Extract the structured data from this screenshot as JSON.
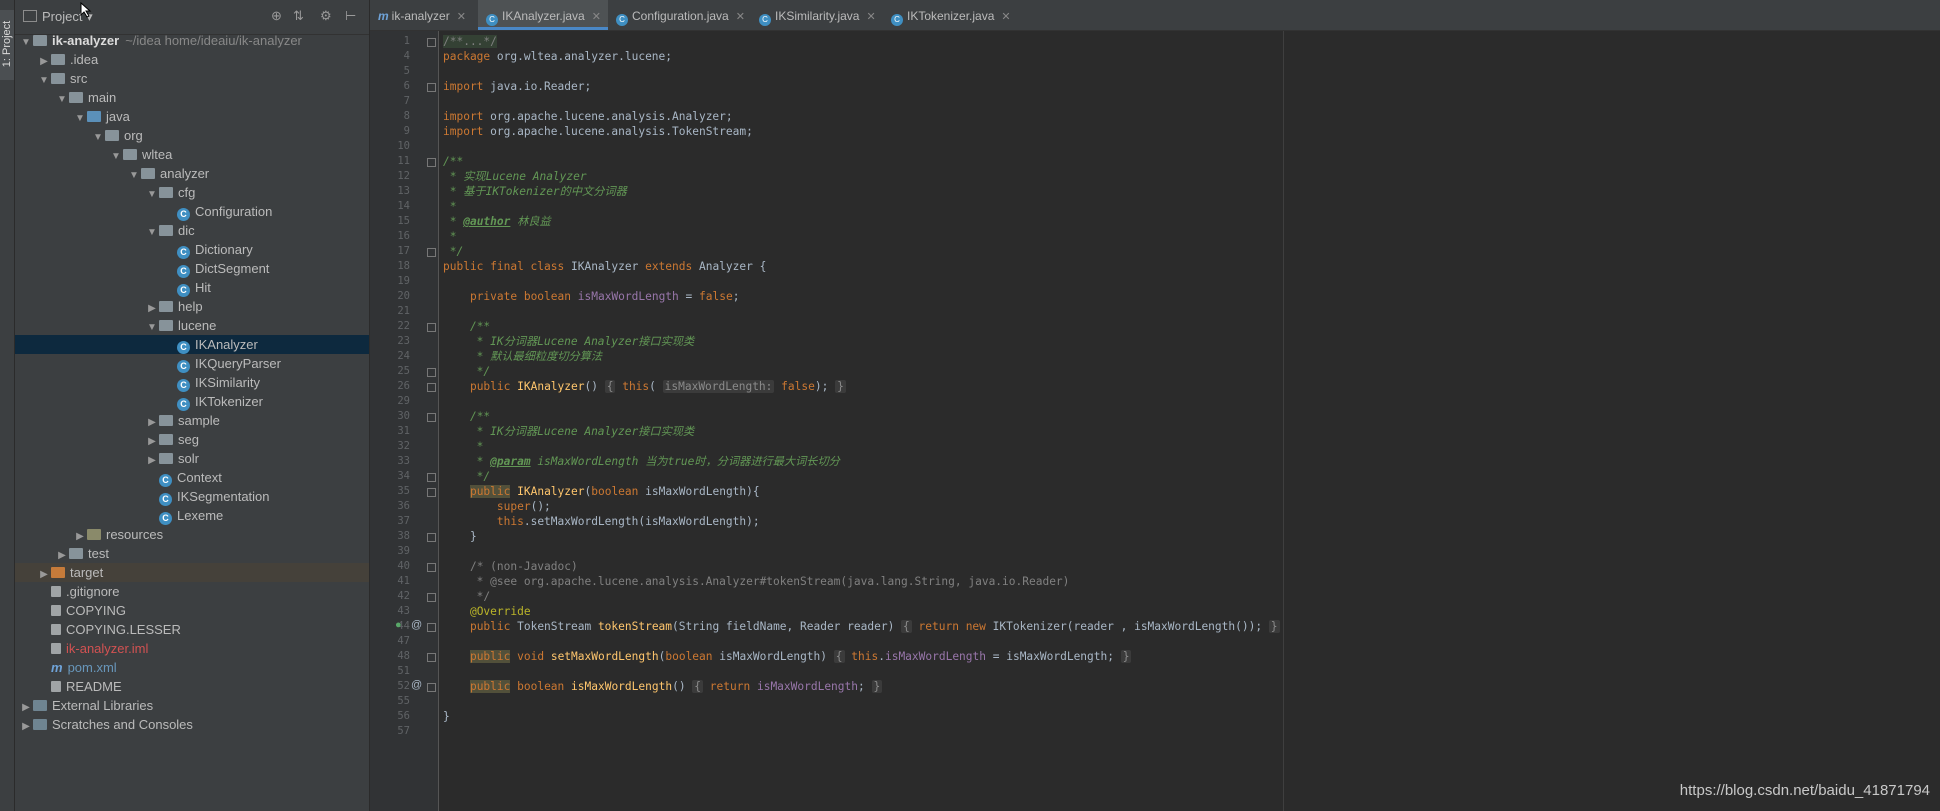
{
  "sidebar_strip": {
    "tab_label": "1: Project"
  },
  "project_panel": {
    "title": "Project",
    "tree": [
      {
        "label": "ik-analyzer",
        "suffix": "~/idea home/ideaiu/ik-analyzer",
        "depth": 0,
        "arrow": "down",
        "icon": "project-folder",
        "bold": true
      },
      {
        "label": ".idea",
        "depth": 1,
        "arrow": "right",
        "icon": "folder"
      },
      {
        "label": "src",
        "depth": 1,
        "arrow": "down",
        "icon": "folder"
      },
      {
        "label": "main",
        "depth": 2,
        "arrow": "down",
        "icon": "folder"
      },
      {
        "label": "java",
        "depth": 3,
        "arrow": "down",
        "icon": "source-folder"
      },
      {
        "label": "org",
        "depth": 4,
        "arrow": "down",
        "icon": "package"
      },
      {
        "label": "wltea",
        "depth": 5,
        "arrow": "down",
        "icon": "package"
      },
      {
        "label": "analyzer",
        "depth": 6,
        "arrow": "down",
        "icon": "package"
      },
      {
        "label": "cfg",
        "depth": 7,
        "arrow": "down",
        "icon": "package"
      },
      {
        "label": "Configuration",
        "depth": 8,
        "arrow": "none",
        "icon": "class"
      },
      {
        "label": "dic",
        "depth": 7,
        "arrow": "down",
        "icon": "package"
      },
      {
        "label": "Dictionary",
        "depth": 8,
        "arrow": "none",
        "icon": "class"
      },
      {
        "label": "DictSegment",
        "depth": 8,
        "arrow": "none",
        "icon": "class"
      },
      {
        "label": "Hit",
        "depth": 8,
        "arrow": "none",
        "icon": "class"
      },
      {
        "label": "help",
        "depth": 7,
        "arrow": "right",
        "icon": "package"
      },
      {
        "label": "lucene",
        "depth": 7,
        "arrow": "down",
        "icon": "package"
      },
      {
        "label": "IKAnalyzer",
        "depth": 8,
        "arrow": "none",
        "icon": "class",
        "selected": true
      },
      {
        "label": "IKQueryParser",
        "depth": 8,
        "arrow": "none",
        "icon": "class"
      },
      {
        "label": "IKSimilarity",
        "depth": 8,
        "arrow": "none",
        "icon": "class"
      },
      {
        "label": "IKTokenizer",
        "depth": 8,
        "arrow": "none",
        "icon": "class"
      },
      {
        "label": "sample",
        "depth": 7,
        "arrow": "right",
        "icon": "package"
      },
      {
        "label": "seg",
        "depth": 7,
        "arrow": "right",
        "icon": "package"
      },
      {
        "label": "solr",
        "depth": 7,
        "arrow": "right",
        "icon": "package"
      },
      {
        "label": "Context",
        "depth": 7,
        "arrow": "none",
        "icon": "class"
      },
      {
        "label": "IKSegmentation",
        "depth": 7,
        "arrow": "none",
        "icon": "class"
      },
      {
        "label": "Lexeme",
        "depth": 7,
        "arrow": "none",
        "icon": "class"
      },
      {
        "label": "resources",
        "depth": 3,
        "arrow": "right",
        "icon": "resources-folder"
      },
      {
        "label": "test",
        "depth": 2,
        "arrow": "right",
        "icon": "folder"
      },
      {
        "label": "target",
        "depth": 1,
        "arrow": "right",
        "icon": "target-folder",
        "dim": true
      },
      {
        "label": ".gitignore",
        "depth": 1,
        "arrow": "none",
        "icon": "file"
      },
      {
        "label": "COPYING",
        "depth": 1,
        "arrow": "none",
        "icon": "file"
      },
      {
        "label": "COPYING.LESSER",
        "depth": 1,
        "arrow": "none",
        "icon": "file"
      },
      {
        "label": "ik-analyzer.iml",
        "depth": 1,
        "arrow": "none",
        "icon": "file",
        "color": "red"
      },
      {
        "label": "pom.xml",
        "depth": 1,
        "arrow": "none",
        "icon": "maven",
        "color": "blue"
      },
      {
        "label": "README",
        "depth": 1,
        "arrow": "none",
        "icon": "file"
      },
      {
        "label": "External Libraries",
        "depth": 0,
        "arrow": "right",
        "icon": "library"
      },
      {
        "label": "Scratches and Consoles",
        "depth": 0,
        "arrow": "right",
        "icon": "scratches"
      }
    ]
  },
  "editor": {
    "tabs": [
      {
        "label": "ik-analyzer",
        "icon": "maven",
        "active": false
      },
      {
        "label": "IKAnalyzer.java",
        "icon": "class",
        "active": true
      },
      {
        "label": "Configuration.java",
        "icon": "class",
        "active": false
      },
      {
        "label": "IKSimilarity.java",
        "icon": "class",
        "active": false
      },
      {
        "label": "IKTokenizer.java",
        "icon": "class",
        "active": false
      }
    ],
    "lines": [
      {
        "n": "1",
        "html": "<span class=\"cm hl\">/**...*/</span>"
      },
      {
        "n": "4",
        "html": "<span class=\"kw\">package</span> org.wltea.analyzer.lucene;"
      },
      {
        "n": "5",
        "html": ""
      },
      {
        "n": "6",
        "html": "<span class=\"kw\">import</span> java.io.Reader;"
      },
      {
        "n": "7",
        "html": ""
      },
      {
        "n": "8",
        "html": "<span class=\"kw\">import</span> org.apache.lucene.analysis.Analyzer;"
      },
      {
        "n": "9",
        "html": "<span class=\"kw\">import</span> org.apache.lucene.analysis.TokenStream;"
      },
      {
        "n": "10",
        "html": ""
      },
      {
        "n": "11",
        "html": "<span class=\"jd\">/**</span>"
      },
      {
        "n": "12",
        "html": "<span class=\"jd\"> * 实现Lucene Analyzer</span>"
      },
      {
        "n": "13",
        "html": "<span class=\"jd\"> * 基于IKTokenizer的中文分词器</span>"
      },
      {
        "n": "14",
        "html": "<span class=\"jd\"> *</span>"
      },
      {
        "n": "15",
        "html": "<span class=\"jd\"> * </span><span class=\"jdt\">@author</span><span class=\"jd\"> 林良益</span>"
      },
      {
        "n": "16",
        "html": "<span class=\"jd\"> *</span>"
      },
      {
        "n": "17",
        "html": "<span class=\"jd\"> */</span>"
      },
      {
        "n": "18",
        "html": "<span class=\"kw\">public final class</span> IKAnalyzer <span class=\"kw\">extends</span> Analyzer {"
      },
      {
        "n": "19",
        "html": ""
      },
      {
        "n": "20",
        "html": "    <span class=\"kw\">private boolean</span> <span class=\"fld\">isMaxWordLength</span> = <span class=\"kw\">false</span>;"
      },
      {
        "n": "21",
        "html": ""
      },
      {
        "n": "22",
        "html": "    <span class=\"jd\">/**</span>"
      },
      {
        "n": "23",
        "html": "<span class=\"jd\">     * IK分词器Lucene Analyzer接口实现类</span>"
      },
      {
        "n": "24",
        "html": "<span class=\"jd\">     * 默认最细粒度切分算法</span>"
      },
      {
        "n": "25",
        "html": "<span class=\"jd\">     */</span>"
      },
      {
        "n": "26",
        "html": "    <span class=\"kw\">public</span> <span class=\"fn\">IKAnalyzer</span>() <span class=\"hint\">{</span> <span class=\"kw\">this</span>( <span class=\"hint\">isMaxWordLength:</span> <span class=\"kw\">false</span>); <span class=\"hint\">}</span>"
      },
      {
        "n": "29",
        "html": ""
      },
      {
        "n": "30",
        "html": "    <span class=\"jd\">/**</span>"
      },
      {
        "n": "31",
        "html": "<span class=\"jd\">     * IK分词器Lucene Analyzer接口实现类</span>"
      },
      {
        "n": "32",
        "html": "<span class=\"jd\">     *</span>"
      },
      {
        "n": "33",
        "html": "<span class=\"jd\">     * </span><span class=\"jdt\">@param</span><span class=\"jd\"> isMaxWordLength 当为true时，分词器进行最大词长切分</span>"
      },
      {
        "n": "34",
        "html": "<span class=\"jd\">     */</span>"
      },
      {
        "n": "35",
        "html": "    <span class=\"kw pub\">public</span> <span class=\"fn\">IKAnalyzer</span>(<span class=\"kw\">boolean</span> isMaxWordLength){"
      },
      {
        "n": "36",
        "html": "        <span class=\"kw\">super</span>();"
      },
      {
        "n": "37",
        "html": "        <span class=\"kw\">this</span>.setMaxWordLength(isMaxWordLength);"
      },
      {
        "n": "38",
        "html": "    }"
      },
      {
        "n": "39",
        "html": ""
      },
      {
        "n": "40",
        "html": "    <span class=\"cm\">/* (non-Javadoc)</span>"
      },
      {
        "n": "41",
        "html": "<span class=\"cm\">     * @see org.apache.lucene.analysis.Analyzer#tokenStream(java.lang.String, java.io.Reader)</span>"
      },
      {
        "n": "42",
        "html": "<span class=\"cm\">     */</span>"
      },
      {
        "n": "43",
        "html": "    <span class=\"ann\">@Override</span>"
      },
      {
        "n": "44",
        "html": "    <span class=\"kw\">public</span> TokenStream <span class=\"fn\">tokenStream</span>(String fieldName, Reader reader) <span class=\"hint\">{</span> <span class=\"kw\">return new</span> IKTokenizer(reader , isMaxWordLength()); <span class=\"hint\">}</span>"
      },
      {
        "n": "47",
        "html": ""
      },
      {
        "n": "48",
        "html": "    <span class=\"kw pub\">public</span> <span class=\"kw\">void</span> <span class=\"fn\">setMaxWordLength</span>(<span class=\"kw\">boolean</span> isMaxWordLength) <span class=\"hint\">{</span> <span class=\"kw\">this</span>.<span class=\"fld\">isMaxWordLength</span> = isMaxWordLength; <span class=\"hint\">}</span>"
      },
      {
        "n": "51",
        "html": ""
      },
      {
        "n": "52",
        "html": "    <span class=\"kw pub\">public</span> <span class=\"kw\">boolean</span> <span class=\"fn\">isMaxWordLength</span>() <span class=\"hint\">{</span> <span class=\"kw\">return</span> <span class=\"fld\">isMaxWordLength</span>; <span class=\"hint\">}</span>"
      },
      {
        "n": "55",
        "html": ""
      },
      {
        "n": "56",
        "html": "}"
      },
      {
        "n": "57",
        "html": ""
      }
    ]
  },
  "watermark": "https://blog.csdn.net/baidu_41871794"
}
